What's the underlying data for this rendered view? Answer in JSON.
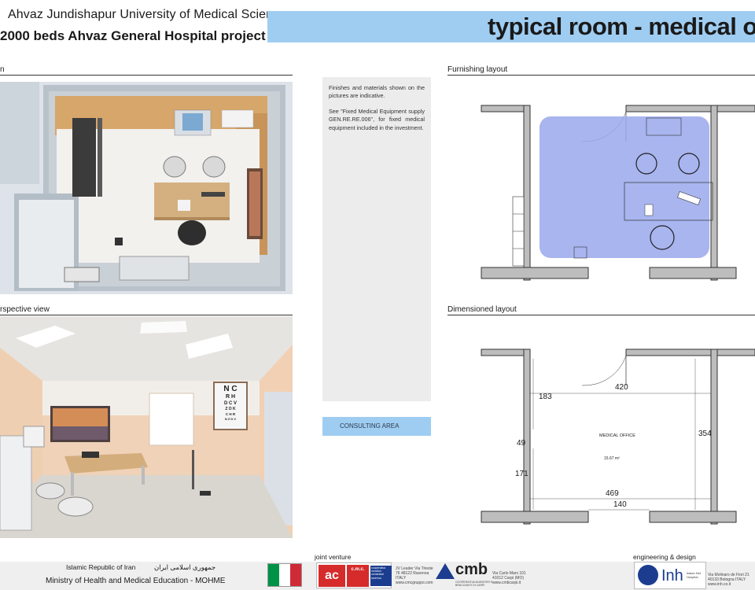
{
  "header": {
    "university": "Ahvaz Jundishapur University of Medical Sciences",
    "project": "2000 beds Ahvaz General Hospital project",
    "title": "typical room  - medical office"
  },
  "sections": {
    "plan": "n",
    "perspective": "rspective view",
    "furnishing": "Furnishing  layout",
    "dimensioned": "Dimensioned layout"
  },
  "notes": {
    "p1": "Finishes and materials  shown on the pictures are indicative.",
    "p2": "See \"Fixed Medical Equipment supply GEN.RE.RE.006\", for  fixed medical equipment included in the investment."
  },
  "area_label": "CONSULTING AREA",
  "dimensions": {
    "width_top": "420",
    "left_upper": "183",
    "height": "354",
    "room_name": "MEDICAL OFFICE",
    "room_area": "15.67 m²",
    "left_small": "49",
    "left_lower": "171",
    "width_bottom": "469",
    "door": "140"
  },
  "eye_chart": {
    "row1": "N C",
    "row2": "R H",
    "row3": "D C V",
    "row4": "Z O K",
    "row5": "C H R",
    "row6": "N Z D V"
  },
  "footer": {
    "country": "Islamic Republic of Iran",
    "country_fa": "جمهوری اسلامی ایران",
    "ministry": "Ministry of Health and Medical Education - MOHME",
    "jv_label": "joint venture",
    "eng_label": "engineering & design",
    "logo1": "c.m.c.",
    "logo1b": "cooperativa muratori cementisti ravenna",
    "addr1": "JV Leader Via Trieste 76 48122 Ravenna ITALY www.cmcgruppo.com",
    "logo2": "cmb",
    "logo2b": "COOPERATIVA MURATORI E BRACCIANTI DI CARPI",
    "addr2": "Via Carlo Marx 101 41012 Carpi (MO) www.cmbcarpi.it",
    "logo3": "Inh",
    "logo3b": "Italian Net Hospital",
    "addr3": "Via Molinaro de Fiori 21 40133 Bologna ITALY www.inh.co.it"
  },
  "colors": {
    "accent": "#9fcdf2",
    "area_fill": "#99a8ec",
    "wall": "#bdbdbd"
  }
}
